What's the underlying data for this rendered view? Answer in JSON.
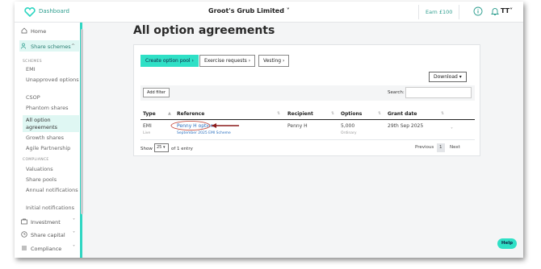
{
  "topbar": {
    "dashboard_label": "Dashboard",
    "company_name": "Groot's Grub Limited",
    "earn_label": "Earn £100",
    "user_initials": "TT"
  },
  "sidebar": {
    "home": "Home",
    "share_schemes": "Share schemes",
    "schemes_section": "SCHEMES",
    "schemes": [
      "EMI",
      "Unapproved options",
      "CSOP",
      "Phantom shares",
      "All option agreements",
      "Growth shares",
      "Agile Partnership"
    ],
    "compliance_section": "COMPLIANCE",
    "compliance_items": [
      "Valuations",
      "Share pools",
      "Annual notifications",
      "Initial notifications"
    ],
    "investment": "Investment",
    "share_capital": "Share capital",
    "compliance": "Compliance"
  },
  "main": {
    "title": "All option agreements",
    "actions": {
      "create_pool": "Create option pool",
      "exercise_requests": "Exercise requests",
      "vesting": "Vesting",
      "download": "Download"
    },
    "filter": {
      "add_filter": "Add filter",
      "search_label": "Search:",
      "search_value": ""
    },
    "table": {
      "headers": [
        "Type",
        "Reference",
        "Recipient",
        "Options",
        "Grant date"
      ],
      "rows": [
        {
          "type": "EMI",
          "type_status": "Live",
          "reference": "Penny H option",
          "scheme": "September 2025 EMI Scheme",
          "recipient": "Penny H",
          "options": "5,000",
          "options_class": "Ordinary",
          "grant_date": "29th Sep 2025"
        }
      ]
    },
    "footer": {
      "show_label": "Show",
      "page_size": "25",
      "entries_label": "of 1 entry",
      "previous": "Previous",
      "current_page": "1",
      "next": "Next"
    }
  },
  "help_label": "Help",
  "colors": {
    "accent": "#2fe0c6",
    "link": "#2a6fbf",
    "annotation": "#c0392b"
  }
}
